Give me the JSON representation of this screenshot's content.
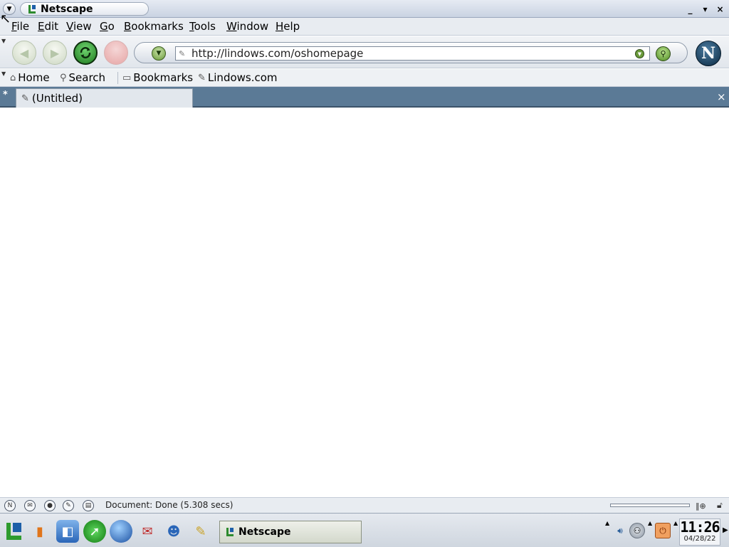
{
  "window": {
    "title": "Netscape",
    "controls": {
      "minimize": "_",
      "maximize": "▾",
      "close": "×"
    }
  },
  "menubar": {
    "items": [
      {
        "label": "File",
        "underline": "F",
        "rest": "ile"
      },
      {
        "label": "Edit",
        "underline": "E",
        "rest": "dit"
      },
      {
        "label": "View",
        "underline": "V",
        "rest": "iew"
      },
      {
        "label": "Go",
        "underline": "G",
        "rest": "o"
      },
      {
        "label": "Bookmarks",
        "underline": "B",
        "rest": "ookmarks"
      },
      {
        "label": "Tools",
        "underline": "T",
        "rest": "ools"
      },
      {
        "label": "Window",
        "underline": "W",
        "rest": "indow"
      },
      {
        "label": "Help",
        "underline": "H",
        "rest": "elp"
      }
    ]
  },
  "navigation": {
    "back_icon": "◀",
    "forward_icon": "▶",
    "reload_icon": "⟳",
    "url": "http://lindows.com/oshomepage",
    "logo_letter": "N"
  },
  "personal_toolbar": {
    "home": "Home",
    "search": "Search",
    "bookmarks": "Bookmarks",
    "lindows": "Lindows.com"
  },
  "tabs": {
    "star": "*",
    "active_title": "(Untitled)",
    "close": "×"
  },
  "status": {
    "text": "Document: Done (5.308 secs)"
  },
  "taskbar": {
    "task_label": "Netscape",
    "clock_time": "11:26",
    "clock_date": "04/28/22"
  },
  "colors": {
    "tab_bar": "#5b7a96",
    "reload_green": "#1f7a1f",
    "netscape_logo": "#0b2a42"
  }
}
